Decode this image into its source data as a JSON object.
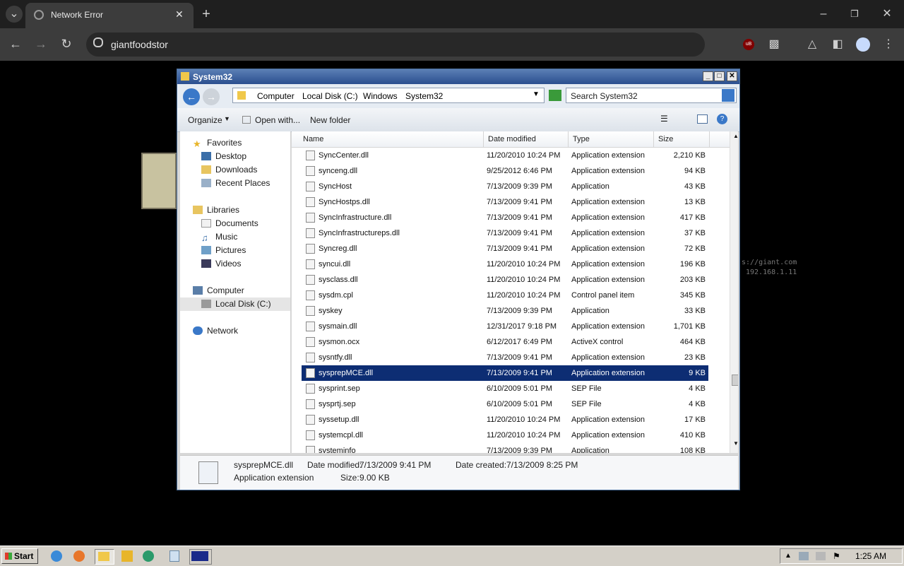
{
  "browser": {
    "tab_title": "Network Error",
    "address": "giantfoodstor",
    "ext_badge": "uB"
  },
  "background": {
    "url_hint": "s://giant.com",
    "ip_hint": "192.168.1.11"
  },
  "window": {
    "title": "System32",
    "breadcrumb": [
      "Computer",
      "Local Disk (C:)",
      "Windows",
      "System32"
    ],
    "search_placeholder": "Search System32",
    "commands": {
      "organize": "Organize",
      "open_with": "Open with...",
      "new_folder": "New folder"
    }
  },
  "nav": {
    "favorites": "Favorites",
    "desktop": "Desktop",
    "downloads": "Downloads",
    "recent": "Recent Places",
    "libraries": "Libraries",
    "documents": "Documents",
    "music": "Music",
    "pictures": "Pictures",
    "videos": "Videos",
    "computer": "Computer",
    "local_disk": "Local Disk (C:)",
    "network": "Network"
  },
  "columns": {
    "name": "Name",
    "date": "Date modified",
    "type": "Type",
    "size": "Size"
  },
  "files": [
    {
      "name": "SyncCenter.dll",
      "date": "11/20/2010 10:24 PM",
      "type": "Application extension",
      "size": "2,210 KB"
    },
    {
      "name": "synceng.dll",
      "date": "9/25/2012 6:46 PM",
      "type": "Application extension",
      "size": "94 KB"
    },
    {
      "name": "SyncHost",
      "date": "7/13/2009 9:39 PM",
      "type": "Application",
      "size": "43 KB"
    },
    {
      "name": "SyncHostps.dll",
      "date": "7/13/2009 9:41 PM",
      "type": "Application extension",
      "size": "13 KB"
    },
    {
      "name": "SyncInfrastructure.dll",
      "date": "7/13/2009 9:41 PM",
      "type": "Application extension",
      "size": "417 KB"
    },
    {
      "name": "SyncInfrastructureps.dll",
      "date": "7/13/2009 9:41 PM",
      "type": "Application extension",
      "size": "37 KB"
    },
    {
      "name": "Syncreg.dll",
      "date": "7/13/2009 9:41 PM",
      "type": "Application extension",
      "size": "72 KB"
    },
    {
      "name": "syncui.dll",
      "date": "11/20/2010 10:24 PM",
      "type": "Application extension",
      "size": "196 KB"
    },
    {
      "name": "sysclass.dll",
      "date": "11/20/2010 10:24 PM",
      "type": "Application extension",
      "size": "203 KB"
    },
    {
      "name": "sysdm.cpl",
      "date": "11/20/2010 10:24 PM",
      "type": "Control panel item",
      "size": "345 KB"
    },
    {
      "name": "syskey",
      "date": "7/13/2009 9:39 PM",
      "type": "Application",
      "size": "33 KB"
    },
    {
      "name": "sysmain.dll",
      "date": "12/31/2017 9:18 PM",
      "type": "Application extension",
      "size": "1,701 KB"
    },
    {
      "name": "sysmon.ocx",
      "date": "6/12/2017 6:49 PM",
      "type": "ActiveX control",
      "size": "464 KB"
    },
    {
      "name": "sysntfy.dll",
      "date": "7/13/2009 9:41 PM",
      "type": "Application extension",
      "size": "23 KB"
    },
    {
      "name": "sysprepMCE.dll",
      "date": "7/13/2009 9:41 PM",
      "type": "Application extension",
      "size": "9 KB"
    },
    {
      "name": "sysprint.sep",
      "date": "6/10/2009 5:01 PM",
      "type": "SEP File",
      "size": "4 KB"
    },
    {
      "name": "sysprtj.sep",
      "date": "6/10/2009 5:01 PM",
      "type": "SEP File",
      "size": "4 KB"
    },
    {
      "name": "syssetup.dll",
      "date": "11/20/2010 10:24 PM",
      "type": "Application extension",
      "size": "17 KB"
    },
    {
      "name": "systemcpl.dll",
      "date": "11/20/2010 10:24 PM",
      "type": "Application extension",
      "size": "410 KB"
    },
    {
      "name": "systeminfo",
      "date": "7/13/2009 9:39 PM",
      "type": "Application",
      "size": "108 KB"
    }
  ],
  "details": {
    "name": "sysprepMCE.dll",
    "kind": "Application extension",
    "modified_label": "Date modified:",
    "modified": "7/13/2009 9:41 PM",
    "created_label": "Date created:",
    "created": "7/13/2009 8:25 PM",
    "size_label": "Size:",
    "size": "9.00 KB"
  },
  "taskbar": {
    "start": "Start",
    "clock": "1:25 AM"
  },
  "colors": {
    "selection": "#0d2d73",
    "title_bar": "#2b4f8f"
  }
}
